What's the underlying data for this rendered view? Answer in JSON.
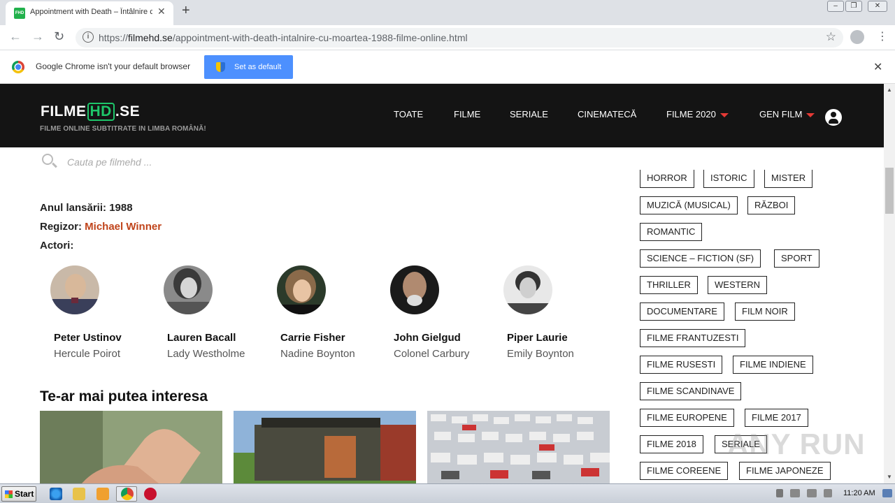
{
  "browser": {
    "tab_title": "Appointment with Death – Întâlnire c",
    "favicon_text": "FHD",
    "url_prefix": "https://",
    "url_domain": "filmehd.se",
    "url_path": "/appointment-with-death-intalnire-cu-moartea-1988-filme-online.html",
    "infobar_text": "Google Chrome isn't your default browser",
    "set_default_label": "Set as default"
  },
  "site": {
    "logo_left": "FILME",
    "logo_hd": "HD",
    "logo_right": ".SE",
    "tagline": "FILME ONLINE SUBTITRATE IN LIMBA ROMÂNĂ!",
    "nav": [
      "TOATE",
      "FILME",
      "SERIALE",
      "CINEMATECĂ",
      "FILME 2020",
      "GEN FILM"
    ],
    "search_placeholder": "Cauta pe filmehd ..."
  },
  "movie": {
    "year_label": "Anul lansării:",
    "year": "1988",
    "director_label": "Regizor:",
    "director": "Michael Winner",
    "actors_label": "Actori:",
    "actors": [
      {
        "name": "Peter Ustinov",
        "role": "Hercule Poirot"
      },
      {
        "name": "Lauren Bacall",
        "role": "Lady Westholme"
      },
      {
        "name": "Carrie Fisher",
        "role": "Nadine Boynton"
      },
      {
        "name": "John Gielgud",
        "role": "Colonel Carbury"
      },
      {
        "name": "Piper Laurie",
        "role": "Emily Boynton"
      }
    ]
  },
  "related_title": "Te-ar mai putea interesa",
  "genres": [
    "HORROR",
    "ISTORIC",
    "MISTER",
    "MUZICĂ (MUSICAL)",
    "RĂZBOI",
    "ROMANTIC",
    "SCIENCE – FICTION (SF)",
    "SPORT",
    "THRILLER",
    "WESTERN",
    "DOCUMENTARE",
    "FILM NOIR",
    "FILME FRANTUZESTI",
    "FILME RUSESTI",
    "FILME INDIENE",
    "FILME SCANDINAVE",
    "FILME EUROPENE",
    "FILME 2017",
    "FILME 2018",
    "SERIALE",
    "FILME COREENE",
    "FILME JAPONEZE"
  ],
  "watermark": "ANY RUN",
  "taskbar": {
    "start_label": "Start",
    "clock": "11:20 AM"
  }
}
